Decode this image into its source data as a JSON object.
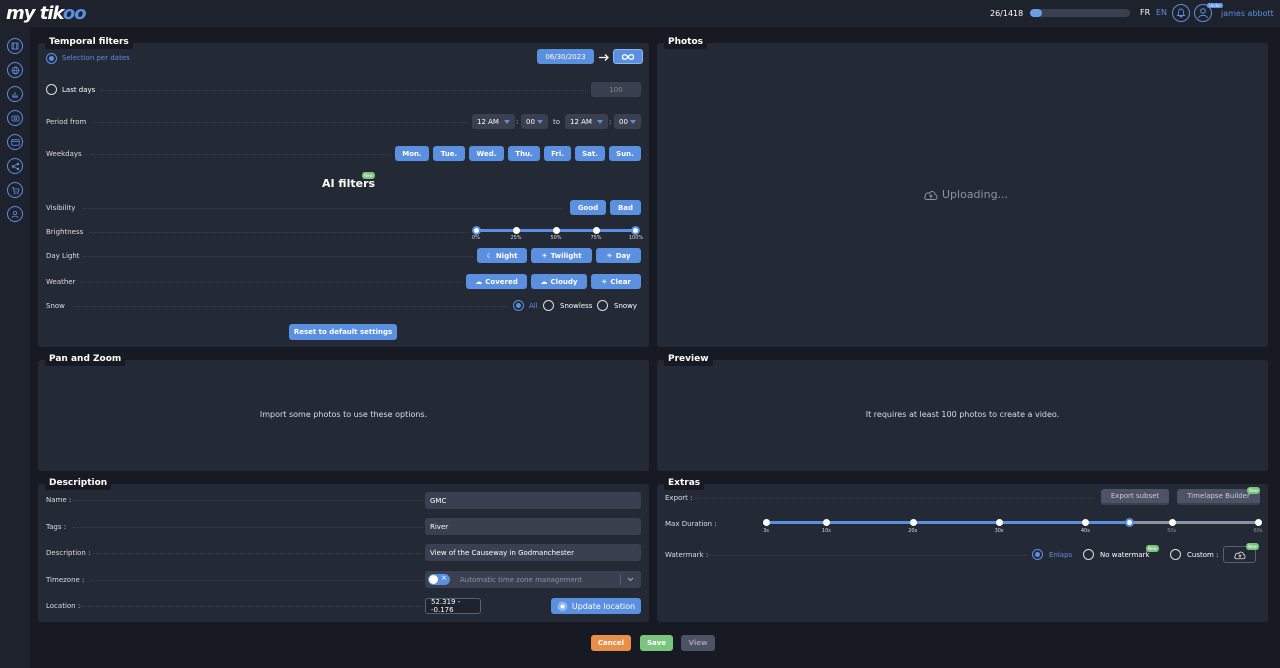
{
  "header": {
    "logo_text": "my tik",
    "logo_suffix": "oo",
    "counter": "26/1418",
    "progress": 0.12,
    "lang_fr": "FR",
    "lang_en": "EN",
    "badge": "Under",
    "user_name": "james abbott",
    "accent": "#5b8fe0"
  },
  "nav_icons": [
    "film-icon",
    "globe-icon",
    "chart-icon",
    "camera-icon",
    "card-icon",
    "share-icon",
    "cart-icon",
    "user-settings-icon"
  ],
  "temporal": {
    "title": "Temporal filters",
    "selection_label": "Selection per dates",
    "date_value": "06/30/2023",
    "last_days_label": "Last days",
    "last_days_value": "100",
    "period_label": "Period from",
    "from_hour": "12 AM",
    "from_min": "00",
    "to_label": "to",
    "to_hour": "12 AM",
    "to_min": "00",
    "weekdays_label": "Weekdays",
    "weekdays": [
      "Mon.",
      "Tue.",
      "Wed.",
      "Thu.",
      "Fri.",
      "Sat.",
      "Sun."
    ],
    "ai_title": "AI filters",
    "new_badge": "New",
    "visibility_label": "Visibility",
    "visibility_good": "Good",
    "visibility_bad": "Bad",
    "brightness_label": "Brightness",
    "brightness_ticks": [
      "0%",
      "25%",
      "50%",
      "75%",
      "100%"
    ],
    "daylight_label": "Day Light",
    "daylight": [
      "Night",
      "Twilight",
      "Day"
    ],
    "weather_label": "Weather",
    "weather": [
      "Covered",
      "Cloudy",
      "Clear"
    ],
    "snow_label": "Snow",
    "snow_all": "All",
    "snow_snowless": "Snowless",
    "snow_snowy": "Snowy",
    "reset_label": "Reset to default settings"
  },
  "photos": {
    "title": "Photos",
    "status": "Uploading..."
  },
  "panzoom": {
    "title": "Pan and Zoom",
    "message": "Import some photos to use these options."
  },
  "preview": {
    "title": "Preview",
    "message": "It requires at least 100 photos to create a video."
  },
  "description": {
    "title": "Description",
    "name_label": "Name :",
    "name_value": "GMC",
    "tags_label": "Tags :",
    "tags_value": "River",
    "desc_label": "Description :",
    "desc_value": "View of the Causeway in Godmanchester",
    "timezone_label": "Timezone  :",
    "timezone_value": "Automatic time zone management",
    "location_label": "Location :",
    "location_value": "52.319 - -0.176",
    "update_location": "Update location"
  },
  "extras": {
    "title": "Extras",
    "export_label": "Export :",
    "export_subset": "Export subset",
    "timelapse_builder": "Timelapse Builder",
    "new_badge": "New",
    "duration_label": "Max Duration :",
    "duration_ticks": [
      "3s",
      "10s",
      "20s",
      "30s",
      "40s",
      "50s",
      "60s"
    ],
    "duration_selected": "45s",
    "watermark_label": "Watermark :",
    "wm_enlaps": "Enlaps",
    "wm_none": "No watermark",
    "wm_custom": "Custom :"
  },
  "footer": {
    "cancel": "Cancel",
    "save": "Save",
    "view": "View",
    "cancel_color": "#e8904a",
    "save_color": "#7bc47f"
  }
}
